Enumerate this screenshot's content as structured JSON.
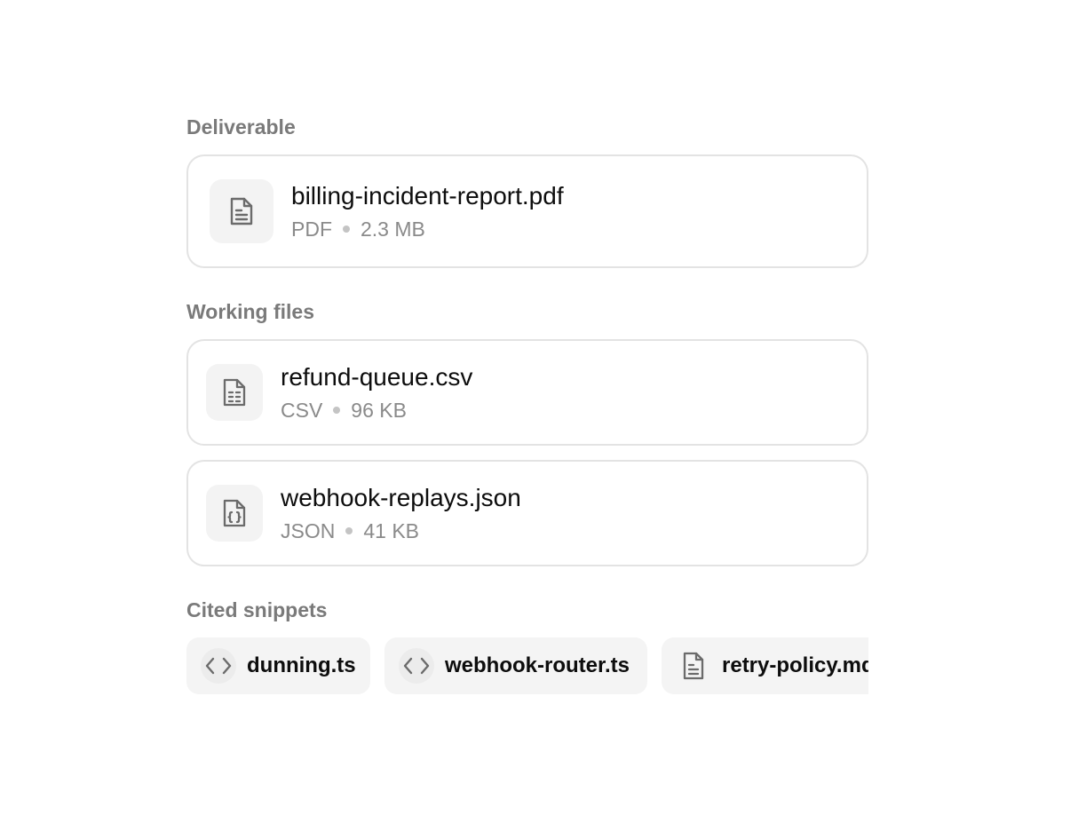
{
  "sections": {
    "deliverable": {
      "label": "Deliverable",
      "file": {
        "name": "billing-incident-report.pdf",
        "type": "PDF",
        "size": "2.3 MB",
        "icon": "document-icon"
      }
    },
    "working_files": {
      "label": "Working files",
      "files": [
        {
          "name": "refund-queue.csv",
          "type": "CSV",
          "size": "96 KB",
          "icon": "spreadsheet-file-icon"
        },
        {
          "name": "webhook-replays.json",
          "type": "JSON",
          "size": "41 KB",
          "icon": "json-file-icon"
        }
      ]
    },
    "cited_snippets": {
      "label": "Cited snippets",
      "items": [
        {
          "label": "dunning.ts",
          "icon": "code-icon"
        },
        {
          "label": "webhook-router.ts",
          "icon": "code-icon"
        },
        {
          "label": "retry-policy.md",
          "icon": "document-icon"
        }
      ]
    }
  }
}
